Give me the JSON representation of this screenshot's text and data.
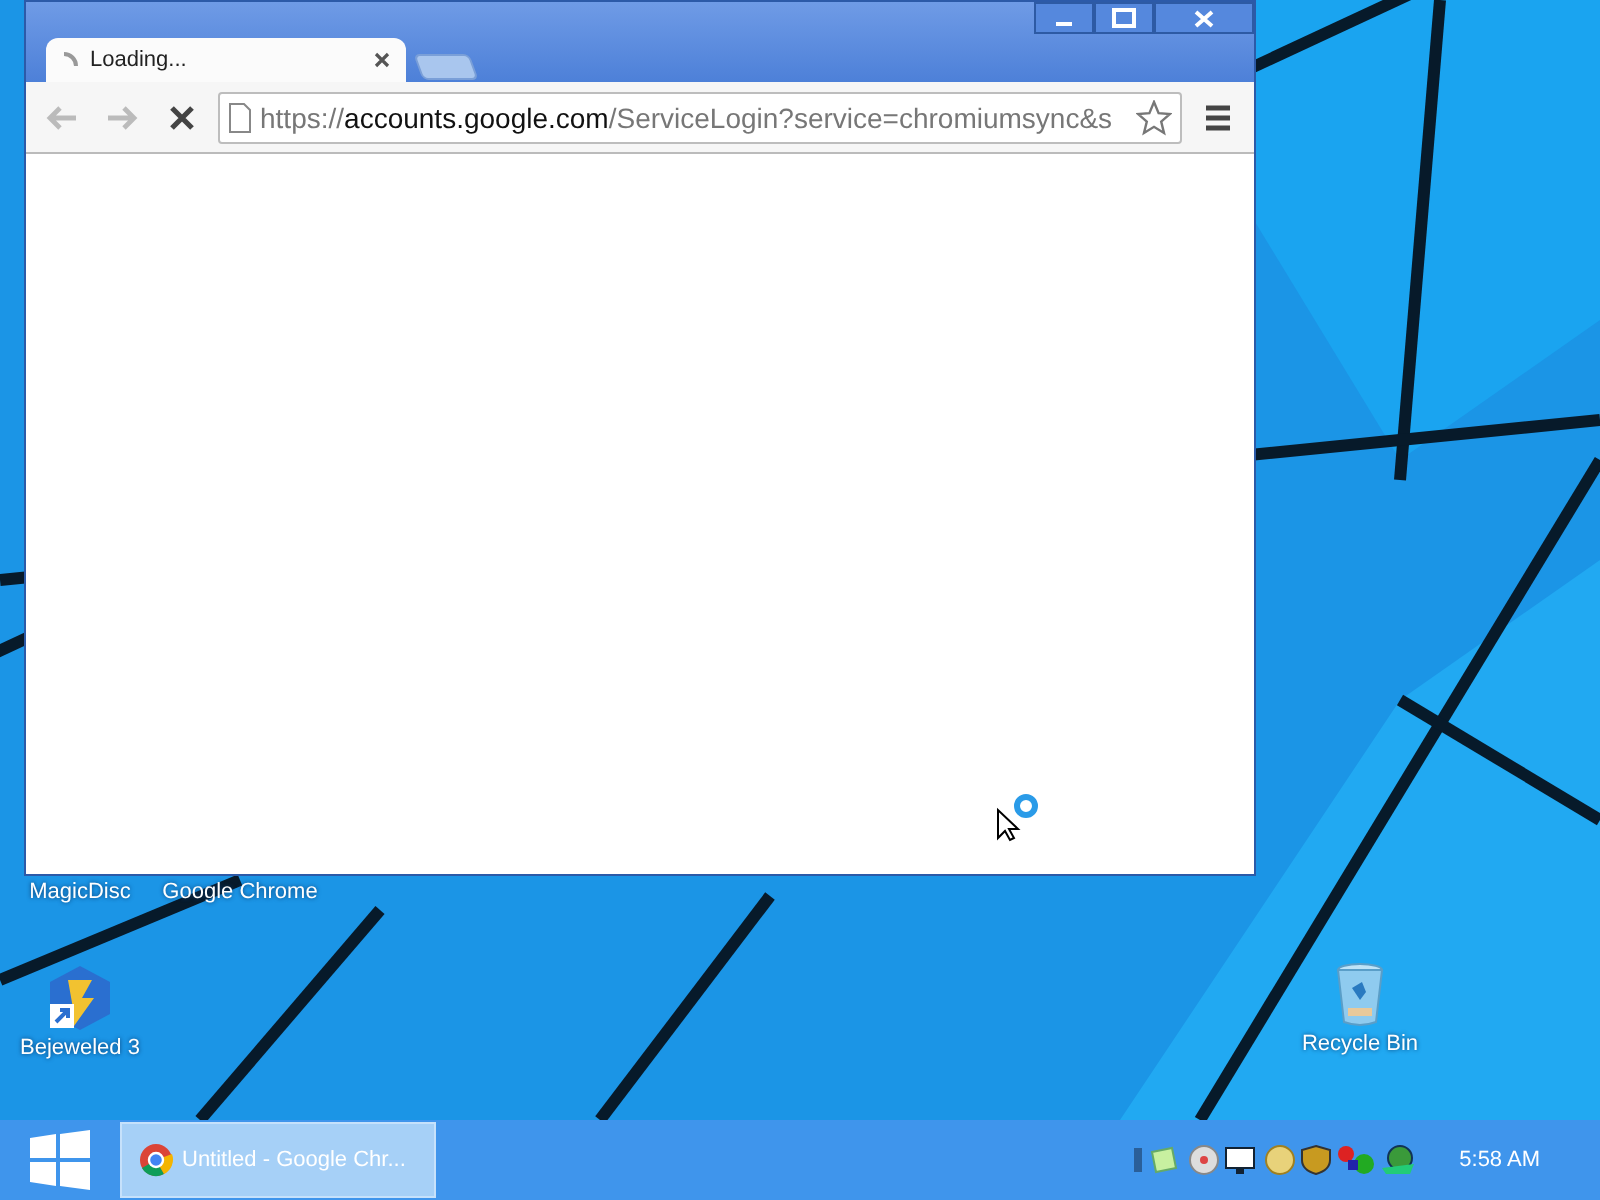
{
  "browser": {
    "tabs": [
      {
        "title": "Loading...",
        "selected": true,
        "loading": true
      }
    ],
    "address": {
      "scheme": "https://",
      "host": "accounts.google.com",
      "path": "/ServiceLogin?service=chromiumsync&s"
    },
    "loading": true
  },
  "desktop_icons": [
    {
      "label": "MagicDisc",
      "kind": "covered"
    },
    {
      "label": "Google Chrome",
      "kind": "covered"
    },
    {
      "label": "Bejeweled 3",
      "kind": "game"
    },
    {
      "label": "Recycle Bin",
      "kind": "bin"
    }
  ],
  "taskbar": {
    "tasks": [
      {
        "label": "Untitled - Google Chr...",
        "selected": true
      }
    ],
    "clock": "5:58 AM"
  }
}
